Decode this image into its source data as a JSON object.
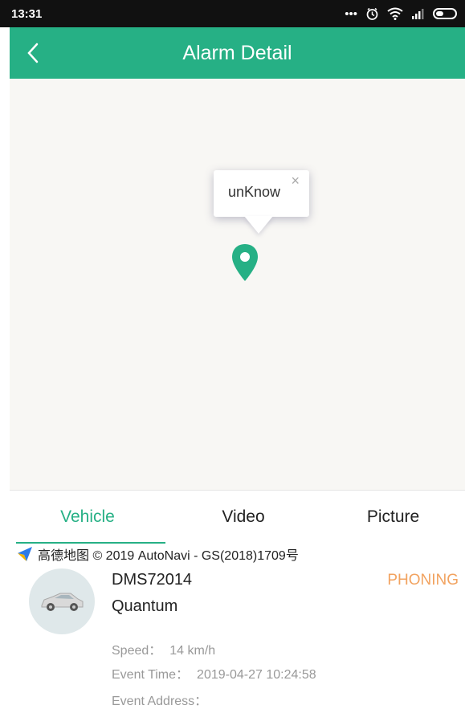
{
  "status_bar": {
    "time": "13:31",
    "icons": [
      "more-icon",
      "alarm-icon",
      "wifi-icon",
      "signal-icon",
      "battery-icon"
    ]
  },
  "header": {
    "title": "Alarm Detail",
    "back_icon": "back-arrow-icon",
    "accent_color": "#26b085"
  },
  "map": {
    "popup_label": "unKnow",
    "popup_close": "×",
    "marker_color": "#26b085",
    "attribution": "高德地图 © 2019 AutoNavi - GS(2018)1709号"
  },
  "tabs": [
    {
      "label": "Vehicle",
      "selected": true
    },
    {
      "label": "Video",
      "selected": false
    },
    {
      "label": "Picture",
      "selected": false
    }
  ],
  "vehicle": {
    "id": "DMS72014",
    "name": "Quantum",
    "status": "PHONING",
    "status_color": "#f2a360",
    "details": [
      {
        "label": "Speed：",
        "value": "14 km/h"
      },
      {
        "label": "Event Time：",
        "value": "2019-04-27 10:24:58"
      },
      {
        "label": "Event Address：",
        "value": ""
      }
    ]
  }
}
